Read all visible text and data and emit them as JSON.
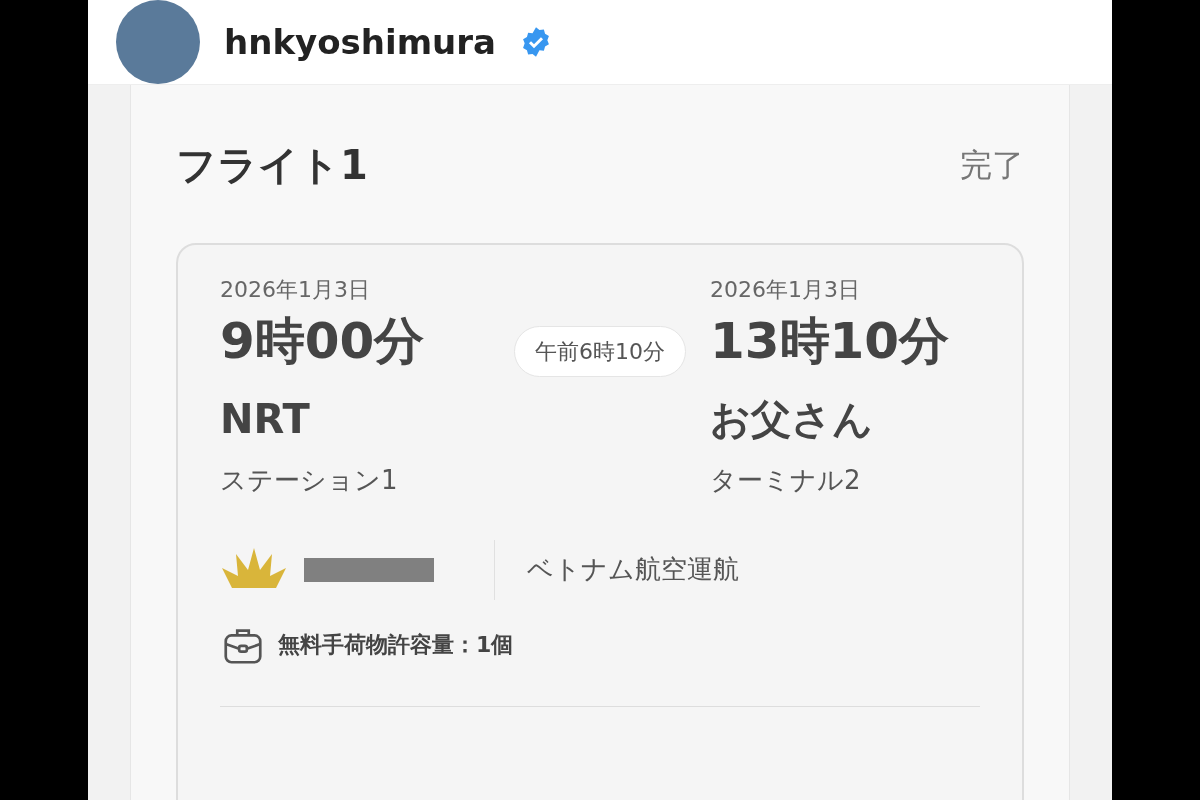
{
  "post_header": {
    "username": "hnkyoshimura",
    "verified": true
  },
  "flight": {
    "title": "フライト1",
    "status": "完了",
    "departure": {
      "date": "2026年1月3日",
      "time": "9時00分",
      "airport": "NRT",
      "terminal": "ステーション1"
    },
    "duration": "午前6時10分",
    "arrival": {
      "date": "2026年1月3日",
      "time": "13時10分",
      "airport": "お父さん",
      "terminal": "ターミナル2"
    },
    "operator": "ベトナム航空運航",
    "baggage": "無料手荷物許容量：1個"
  }
}
